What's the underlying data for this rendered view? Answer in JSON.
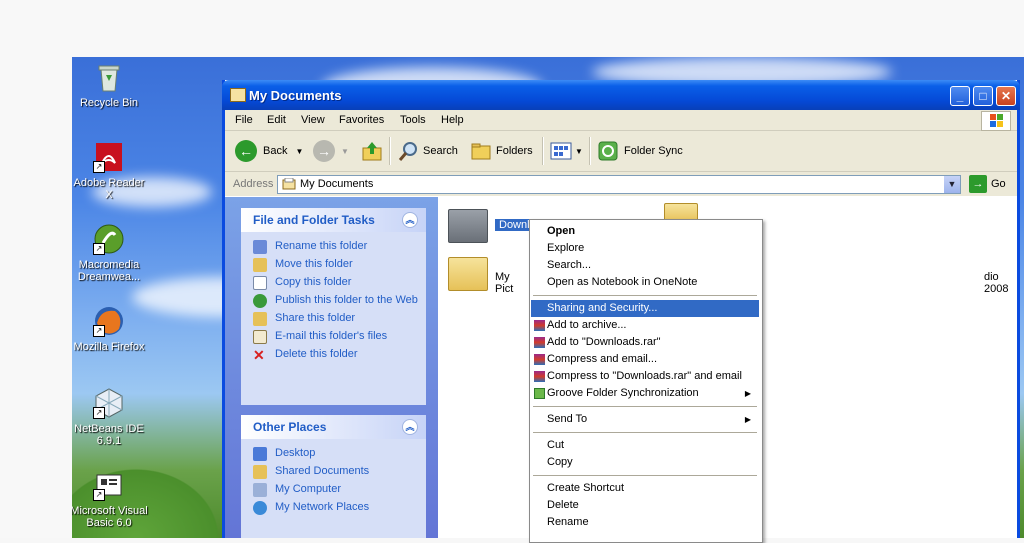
{
  "desktop": {
    "icons": [
      {
        "label": "Recycle Bin",
        "icon": "recycle-bin-icon"
      },
      {
        "label": "Adobe Reader X",
        "icon": "adobe-reader-icon"
      },
      {
        "label": "Macromedia Dreamwea...",
        "icon": "dreamweaver-icon"
      },
      {
        "label": "Mozilla Firefox",
        "icon": "firefox-icon"
      },
      {
        "label": "NetBeans IDE 6.9.1",
        "icon": "netbeans-icon"
      },
      {
        "label": "Microsoft Visual Basic 6.0",
        "icon": "visual-basic-icon"
      }
    ]
  },
  "window": {
    "title": "My Documents",
    "controls": {
      "minimize": "_",
      "maximize": "□",
      "close": "✕"
    }
  },
  "menubar": [
    "File",
    "Edit",
    "View",
    "Favorites",
    "Tools",
    "Help"
  ],
  "toolbar": {
    "back": "Back",
    "search": "Search",
    "folders": "Folders",
    "folder_sync": "Folder Sync"
  },
  "address": {
    "label": "Address",
    "value": "My Documents",
    "go": "Go"
  },
  "tasks_panel": {
    "title": "File and Folder Tasks",
    "items": [
      "Rename this folder",
      "Move this folder",
      "Copy this folder",
      "Publish this folder to the Web",
      "Share this folder",
      "E-mail this folder's files",
      "Delete this folder"
    ]
  },
  "places_panel": {
    "title": "Other Places",
    "items": [
      "Desktop",
      "Shared Documents",
      "My Computer",
      "My Network Places"
    ]
  },
  "files": [
    {
      "name": "Downlo",
      "selected": true
    },
    {
      "name": "My Pict"
    },
    {
      "name": "dio 2008"
    }
  ],
  "context_menu": {
    "items": [
      {
        "label": "Open",
        "bold": true
      },
      {
        "label": "Explore"
      },
      {
        "label": "Search..."
      },
      {
        "label": "Open as Notebook in OneNote"
      },
      {
        "label": "Sharing and Security...",
        "highlighted": true
      },
      {
        "label": "Add to archive...",
        "icon": "winrar-icon"
      },
      {
        "label": "Add to \"Downloads.rar\"",
        "icon": "winrar-icon"
      },
      {
        "label": "Compress and email...",
        "icon": "winrar-icon"
      },
      {
        "label": "Compress to \"Downloads.rar\" and email",
        "icon": "winrar-icon"
      },
      {
        "label": "Groove Folder Synchronization",
        "icon": "groove-icon",
        "submenu": true
      },
      {
        "label": "Send To",
        "submenu": true
      },
      {
        "label": "Cut"
      },
      {
        "label": "Copy"
      },
      {
        "label": "Create Shortcut"
      },
      {
        "label": "Delete"
      },
      {
        "label": "Rename"
      }
    ]
  },
  "colors": {
    "title_bar": "#0549d6",
    "menu_highlight": "#316ac5",
    "task_link": "#215dc6"
  }
}
